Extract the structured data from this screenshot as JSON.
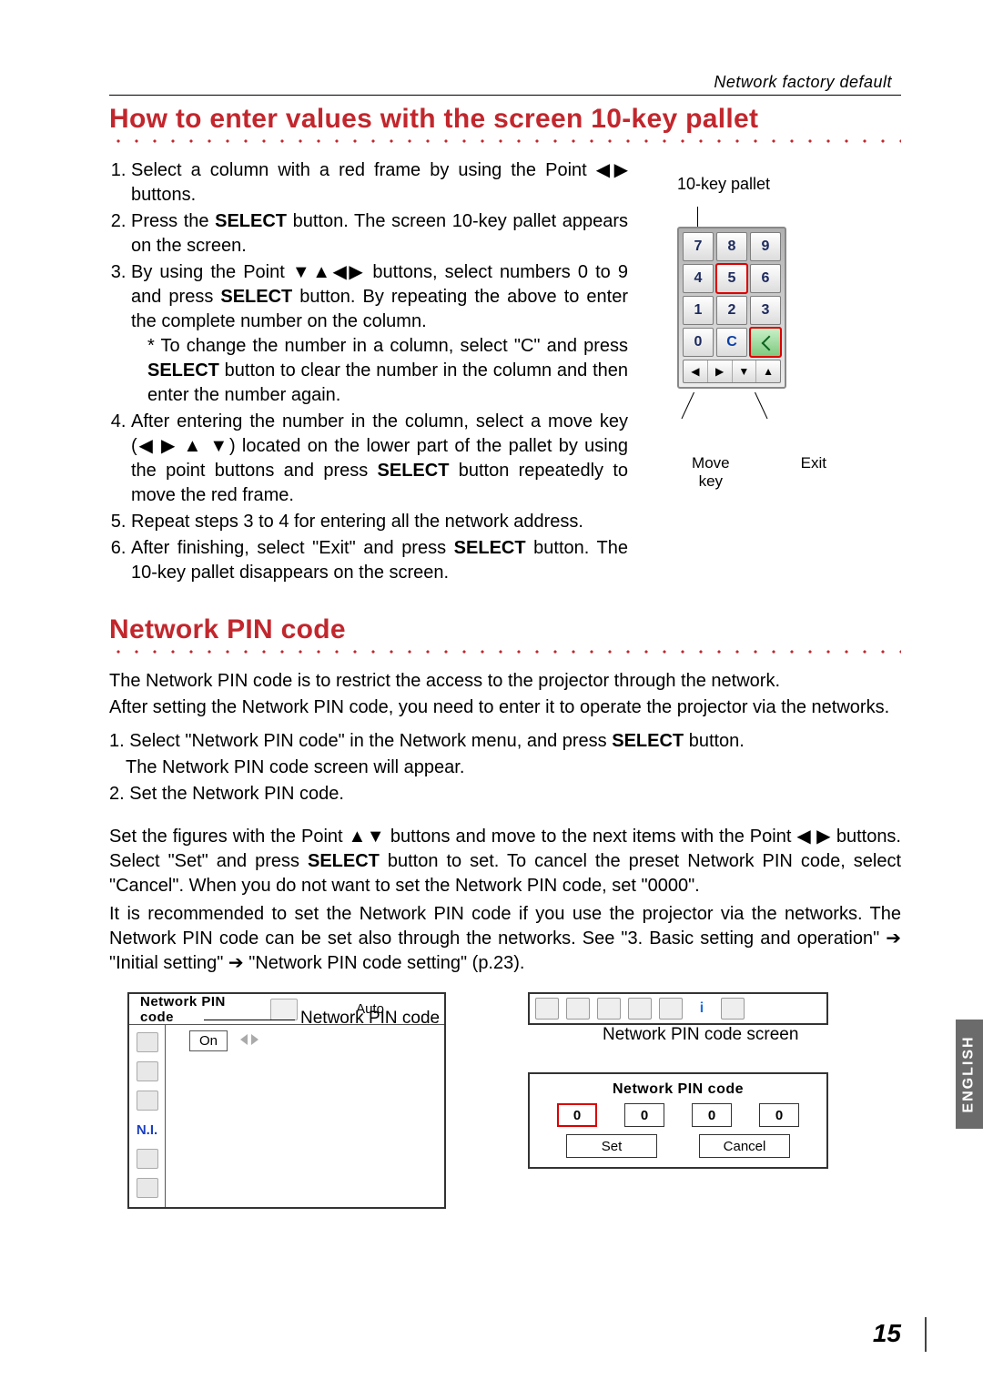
{
  "header_right": "Network factory default",
  "h1": "How to enter values with the screen 10-key pallet",
  "steps": {
    "s1_a": "Select a column with a red frame by using the Point ",
    "s1_b": " buttons.",
    "s2_a": "Press the ",
    "s2_select": "SELECT",
    "s2_b": " button. The screen 10-key pallet appears on the screen.",
    "s3_a": "By using the Point ",
    "s3_b": " buttons, select numbers 0 to 9 and press ",
    "s3_select": "SELECT",
    "s3_c": " button. By repeating the above to enter the complete number on the column.",
    "s3_sub_a": "* To change the number in a column, select \"C\" and press ",
    "s3_sub_select": "SELECT",
    "s3_sub_b": " button to clear the number in the column and then enter the number again.",
    "s4_a": "After entering the number in the column, select a move key (",
    "s4_b": ") located on the lower part of the pallet by using the point buttons and press ",
    "s4_select": "SELECT",
    "s4_c": " button repeatedly to move the red frame.",
    "s5": "Repeat steps 3 to 4 for entering all the network address.",
    "s6_a": "After finishing, select \"Exit\" and press ",
    "s6_select": "SELECT",
    "s6_b": " button. The 10-key pallet disappears on the screen."
  },
  "pallet": {
    "label": "10-key pallet",
    "keys": [
      [
        "7",
        "8",
        "9"
      ],
      [
        "4",
        "5",
        "6"
      ],
      [
        "1",
        "2",
        "3"
      ],
      [
        "0",
        "C",
        "exit"
      ]
    ],
    "move_label": "Move key",
    "exit_label": "Exit"
  },
  "h2": "Network PIN code",
  "pin_intro1": "The Network PIN code is to restrict the access to the projector through the network.",
  "pin_intro2": "After setting the Network PIN code, you need to enter it to operate the projector via the networks.",
  "pin_steps": {
    "p1_a": "1. Select \"Network PIN code\" in the Network menu, and press ",
    "p1_select": "SELECT",
    "p1_b": " button.",
    "p1_c": "The Network PIN code screen will appear.",
    "p2": "2. Set the Network PIN code."
  },
  "pin_para_a": "Set the figures with the Point ",
  "pin_para_b": " buttons and move to the next items with the Point ",
  "pin_para_c": " buttons. Select \"Set\" and press ",
  "pin_para_select": "SELECT",
  "pin_para_d": " button to set. To cancel the preset Network PIN code, select \"Cancel\". When you do not want to set the Network PIN code, set \"0000\".",
  "pin_para2": "It is recommended to set the Network PIN code if you use the projector via the networks. The Network PIN code can be set also through the networks.  See \"3. Basic setting and operation\" ➔ \"Initial setting\" ➔ \"Network PIN code setting\" (p.23).",
  "menu": {
    "title": "Network PIN code",
    "auto": "Auto",
    "on": "On",
    "ni": "N.I.",
    "callout": "Network PIN code"
  },
  "pin_screen": {
    "label": "Network PIN code screen",
    "title": "Network PIN code",
    "digits": [
      "0",
      "0",
      "0",
      "0"
    ],
    "set": "Set",
    "cancel": "Cancel"
  },
  "lang": "ENGLISH",
  "page": "15"
}
